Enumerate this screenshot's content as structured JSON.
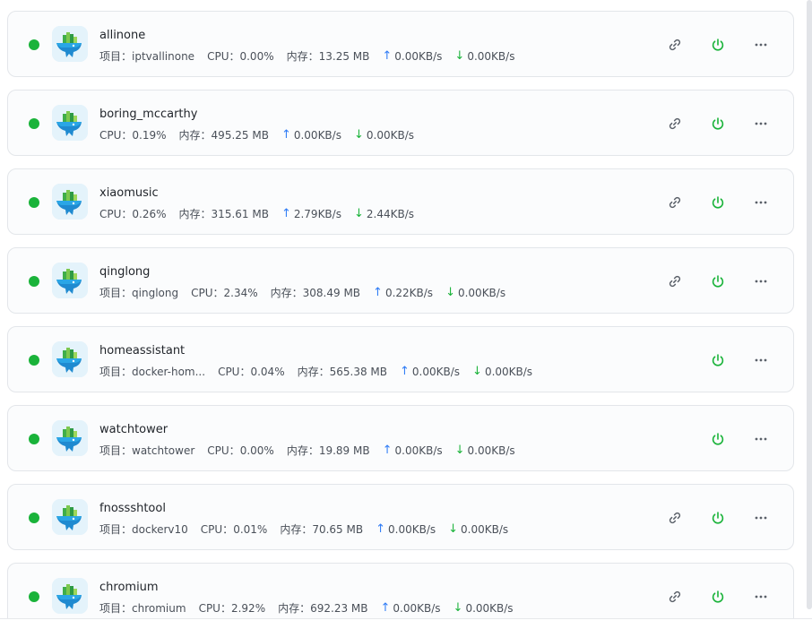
{
  "labels": {
    "project": "项目：",
    "cpu": "CPU：",
    "memory": "内存："
  },
  "icons": {
    "status": "running-status-dot",
    "app": "docker-whale-icon",
    "link": "link-icon",
    "power": "power-icon",
    "more": "more-horizontal-icon",
    "upload": "arrow-up-icon",
    "download": "arrow-down-icon"
  },
  "colors": {
    "status_running": "#1ab33a",
    "power": "#1ab33a",
    "upload": "#2f7cf6",
    "download": "#1ab33a"
  },
  "containers": [
    {
      "name": "allinone",
      "project": "iptvallinone",
      "cpu": "0.00%",
      "memory": "13.25 MB",
      "upload": "0.00KB/s",
      "download": "0.00KB/s",
      "has_link": true
    },
    {
      "name": "boring_mccarthy",
      "cpu": "0.19%",
      "memory": "495.25 MB",
      "upload": "0.00KB/s",
      "download": "0.00KB/s",
      "has_link": true
    },
    {
      "name": "xiaomusic",
      "cpu": "0.26%",
      "memory": "315.61 MB",
      "upload": "2.79KB/s",
      "download": "2.44KB/s",
      "has_link": true
    },
    {
      "name": "qinglong",
      "project": "qinglong",
      "cpu": "2.34%",
      "memory": "308.49 MB",
      "upload": "0.22KB/s",
      "download": "0.00KB/s",
      "has_link": true
    },
    {
      "name": "homeassistant",
      "project": "docker-hom...",
      "cpu": "0.04%",
      "memory": "565.38 MB",
      "upload": "0.00KB/s",
      "download": "0.00KB/s",
      "has_link": false
    },
    {
      "name": "watchtower",
      "project": "watchtower",
      "cpu": "0.00%",
      "memory": "19.89 MB",
      "upload": "0.00KB/s",
      "download": "0.00KB/s",
      "has_link": false
    },
    {
      "name": "fnossshtool",
      "project": "dockerv10",
      "cpu": "0.01%",
      "memory": "70.65 MB",
      "upload": "0.00KB/s",
      "download": "0.00KB/s",
      "has_link": true
    },
    {
      "name": "chromium",
      "project": "chromium",
      "cpu": "2.92%",
      "memory": "692.23 MB",
      "upload": "0.00KB/s",
      "download": "0.00KB/s",
      "has_link": true
    }
  ]
}
